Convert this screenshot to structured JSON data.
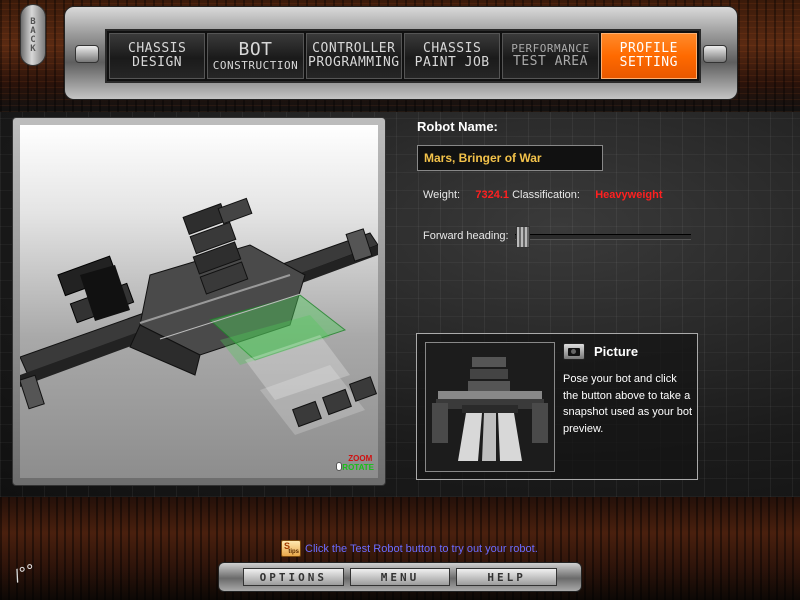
{
  "back_button": {
    "label": "BACK"
  },
  "nav": {
    "tabs": [
      {
        "line1": "CHASSIS",
        "line2": "DESIGN"
      },
      {
        "line1": "BOT",
        "line2": "CONSTRUCTION"
      },
      {
        "line1": "CONTROLLER",
        "line2": "PROGRAMMING"
      },
      {
        "line1": "CHASSIS",
        "line2": "PAINT JOB"
      },
      {
        "line1": "PERFORMANCE",
        "line2": "TEST AREA"
      },
      {
        "line1": "PROFILE",
        "line2": "SETTING",
        "active": true
      }
    ]
  },
  "viewport": {
    "zoom_label": "ZOOM",
    "rotate_label": "ROTATE"
  },
  "profile": {
    "robot_name_label": "Robot Name:",
    "robot_name_value": "Mars, Bringer of War",
    "weight_label": "Weight:",
    "weight_value": "7324.1",
    "classification_label": "Classification:",
    "classification_value": "Heavyweight",
    "forward_heading_label": "Forward heading:",
    "forward_heading_fraction": 0.03
  },
  "picture": {
    "title": "Picture",
    "description": "Pose your bot and click the button above to take a snapshot used as your bot preview."
  },
  "tip": {
    "icon_text": "tips",
    "text": "Click the Test Robot button to try out your robot."
  },
  "bottom_nav": {
    "options": "OPTIONS",
    "menu": "MENU",
    "help": "HELP"
  },
  "colors": {
    "accent_orange": "#ff6a00",
    "name_yellow": "#f3c24a",
    "value_red": "#ff2020",
    "tip_blue": "#6b6bff"
  }
}
